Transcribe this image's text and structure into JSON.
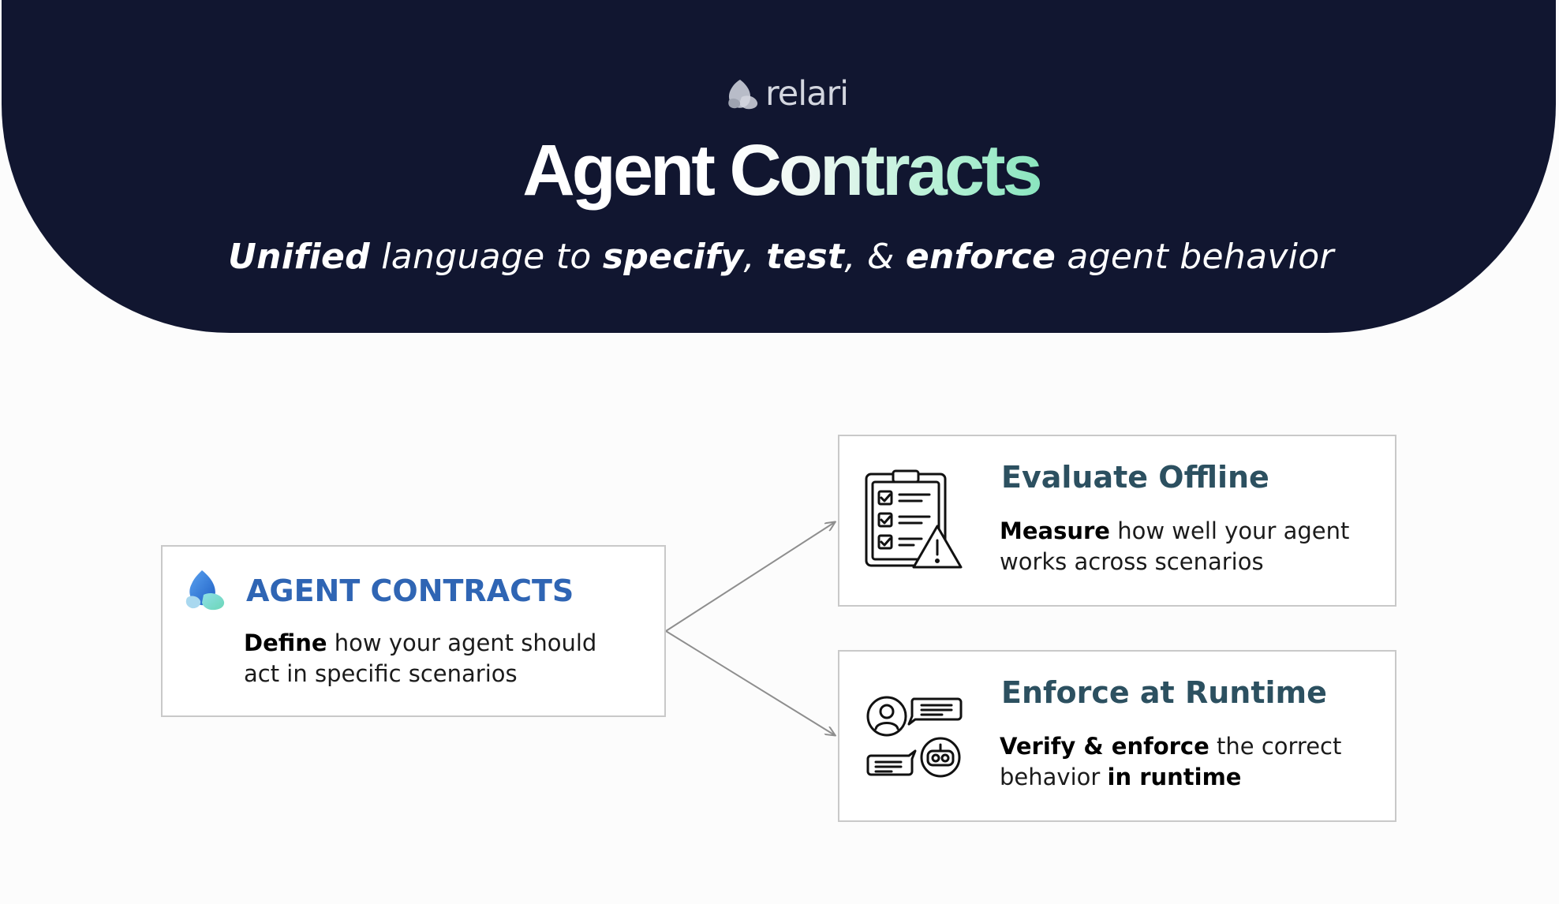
{
  "header": {
    "brand_name": "relari",
    "title_part_1": "Agent",
    "title_part_2": "Contracts",
    "tagline": {
      "w1": "Unified",
      "w2": " language to ",
      "w3": "specify",
      "w4": ", ",
      "w5": "test",
      "w6": ", & ",
      "w7": "enforce",
      "w8": " agent behavior"
    }
  },
  "cards": {
    "define": {
      "title": "AGENT CONTRACTS",
      "desc_bold": "Define",
      "desc_rest": " how your agent should act in specific scenarios",
      "icon": "relari-logo-icon"
    },
    "evaluate": {
      "title": "Evaluate Offline",
      "desc_bold": "Measure",
      "desc_rest": " how well your agent works across scenarios",
      "icon": "checklist-warning-icon"
    },
    "enforce": {
      "title": "Enforce at Runtime",
      "desc_bold_1": "Verify & enforce",
      "desc_mid": " the correct behavior ",
      "desc_bold_2": "in runtime",
      "icon": "user-bot-chat-icon"
    }
  },
  "colors": {
    "hero_bg": "#111630",
    "agent_contracts_title": "#2f65b4",
    "card_title": "#2c5060",
    "title_gradient_end": "#8ae5bf",
    "connector": "#8e8e8e"
  }
}
